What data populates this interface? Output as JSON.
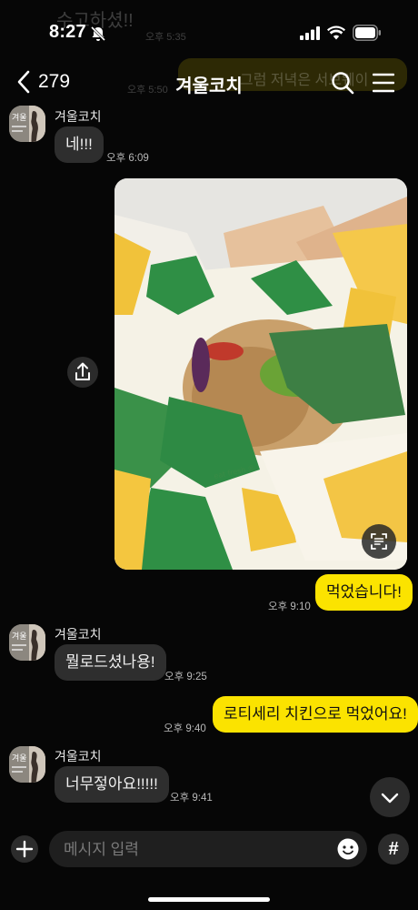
{
  "status_bar": {
    "time": "8:27"
  },
  "header": {
    "back_count": "279",
    "title": "겨울코치"
  },
  "background_ghost": {
    "top_text": "수고하셨!!",
    "top_time": "오후 5:35",
    "mid_text": "그럼 저녁은 서브웨이",
    "mid_time": "오후 5:50"
  },
  "messages": [
    {
      "side": "in",
      "sender": "겨울코치",
      "text": "네!!!",
      "time": "오후 6:09"
    },
    {
      "side": "out",
      "type": "photo",
      "description": "sandwich photo"
    },
    {
      "side": "out",
      "text": "먹었습니다!",
      "time": "오후 9:10"
    },
    {
      "side": "in",
      "sender": "겨울코치",
      "text": "뭘로드셨나용!",
      "time": "오후 9:25"
    },
    {
      "side": "out",
      "text": "로티세리 치킨으로 먹었어요!",
      "time": "오후 9:40"
    },
    {
      "side": "in",
      "sender": "겨울코치",
      "text": "너무젛아요!!!!!",
      "time": "오후 9:41"
    }
  ],
  "input_bar": {
    "placeholder": "메시지 입력",
    "hash_label": "#"
  },
  "avatar_caption": "겨울",
  "colors": {
    "background": "#060606",
    "outgoing_bubble": "#fbe300",
    "incoming_bubble": "#2e2e2e"
  }
}
